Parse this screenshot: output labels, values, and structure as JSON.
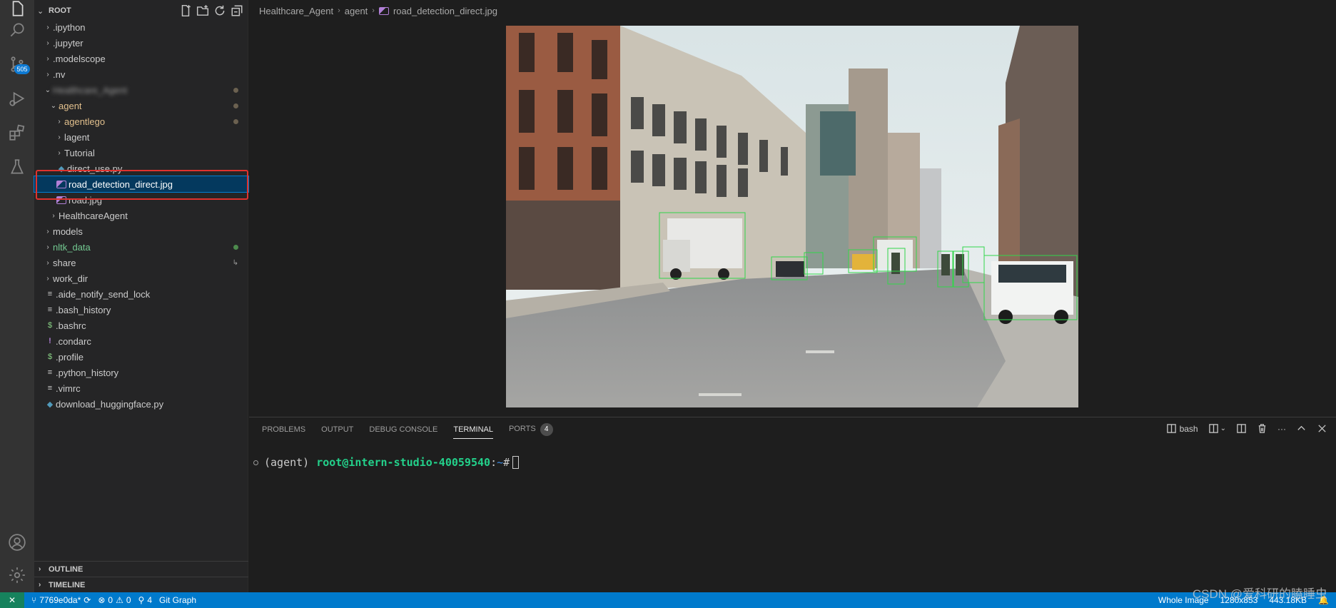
{
  "activity_bar": {
    "scm_badge": "505",
    "icons": [
      "explorer-icon",
      "search-icon",
      "source-control-icon",
      "run-debug-icon",
      "extensions-icon",
      "testing-icon",
      "account-icon",
      "settings-gear-icon"
    ]
  },
  "explorer": {
    "root_label": "ROOT",
    "items": [
      {
        "label": ".ipython"
      },
      {
        "label": ".jupyter"
      },
      {
        "label": ".modelscope"
      },
      {
        "label": ".nv"
      },
      {
        "label": "Healthcare_Agent"
      },
      {
        "label": "agent"
      },
      {
        "label": "agentlego"
      },
      {
        "label": "lagent"
      },
      {
        "label": "Tutorial"
      },
      {
        "label": "direct_use.py"
      },
      {
        "label": "road_detection_direct.jpg"
      },
      {
        "label": "road.jpg"
      },
      {
        "label": "HealthcareAgent"
      },
      {
        "label": "models"
      },
      {
        "label": "nltk_data"
      },
      {
        "label": "share"
      },
      {
        "label": "work_dir"
      },
      {
        "label": ".aide_notify_send_lock"
      },
      {
        "label": ".bash_history"
      },
      {
        "label": ".bashrc"
      },
      {
        "label": ".condarc"
      },
      {
        "label": ".profile"
      },
      {
        "label": ".python_history"
      },
      {
        "label": ".vimrc"
      },
      {
        "label": "download_huggingface.py"
      }
    ],
    "outline_label": "OUTLINE",
    "timeline_label": "TIMELINE"
  },
  "breadcrumb": {
    "parts": [
      "Healthcare_Agent",
      "agent",
      "road_detection_direct.jpg"
    ]
  },
  "panel": {
    "tabs": [
      "PROBLEMS",
      "OUTPUT",
      "DEBUG CONSOLE",
      "TERMINAL",
      "PORTS"
    ],
    "ports_count": "4",
    "shell_label": "bash"
  },
  "terminal": {
    "env": "(agent)",
    "user_host": "root@intern-studio-40059540",
    "colon": ":",
    "path": "~",
    "prompt": "#"
  },
  "status_bar": {
    "branch": "7769e0da*",
    "errors": "0",
    "warnings": "0",
    "ports": "4",
    "git_graph": "Git Graph",
    "image_scope": "Whole Image",
    "image_size": "1280x853",
    "file_size": "443.18KB"
  },
  "watermark": "CSDN @爱科研的瞌睡虫",
  "colors": {
    "accent": "#007acc",
    "selection": "#04395e",
    "highlight_box": "#e0322e"
  }
}
